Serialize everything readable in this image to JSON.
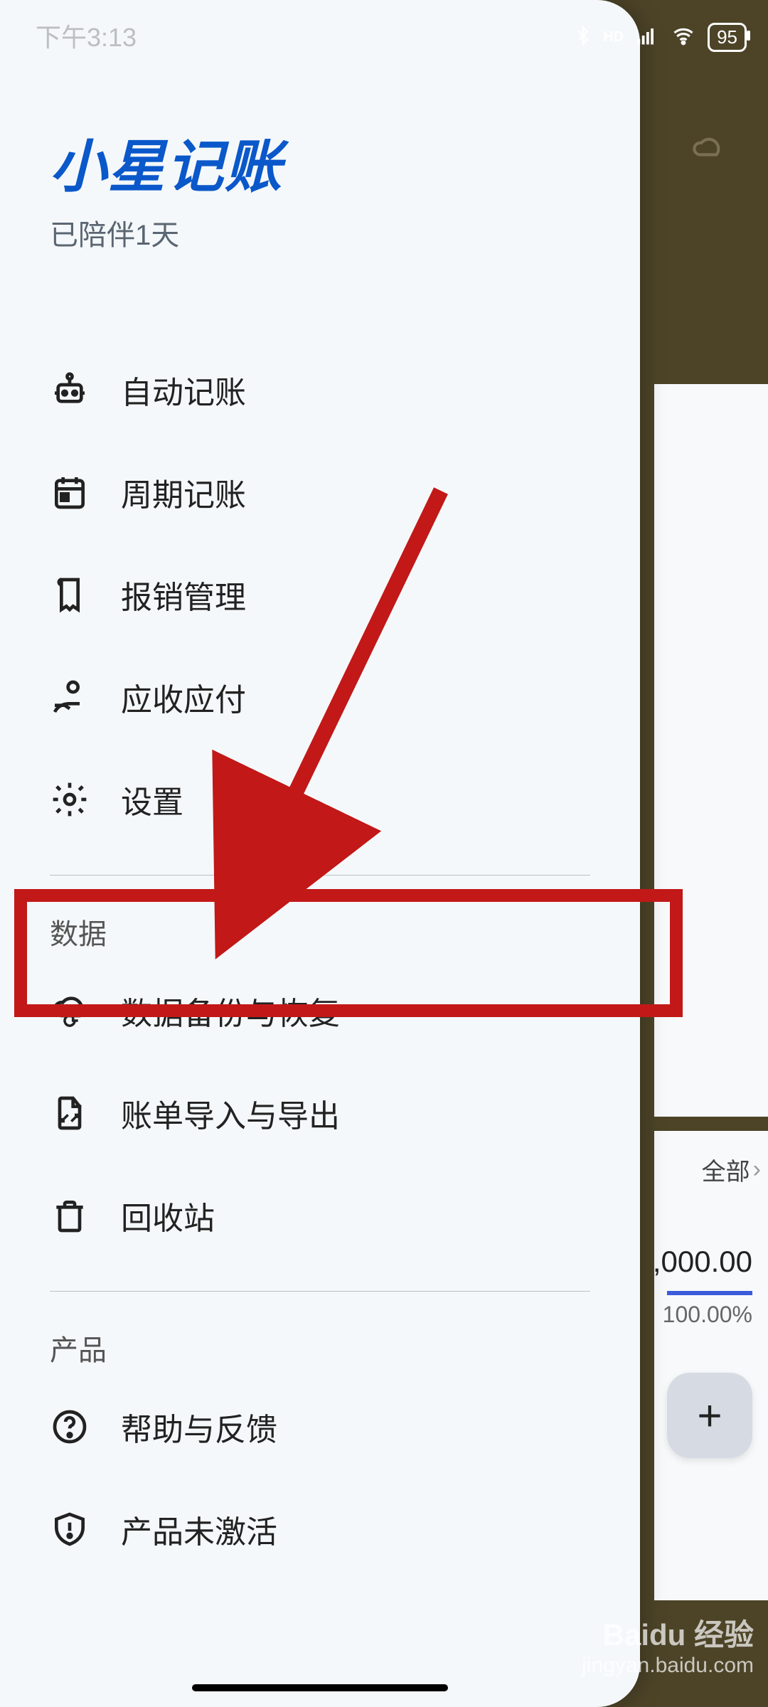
{
  "statusbar": {
    "time": "下午3:13",
    "battery": "95"
  },
  "drawer": {
    "app_title": "小星记账",
    "subtitle": "已陪伴1天",
    "menu_main": [
      {
        "label": "自动记账",
        "icon": "robot-icon"
      },
      {
        "label": "周期记账",
        "icon": "calendar-icon"
      },
      {
        "label": "报销管理",
        "icon": "receipt-icon"
      },
      {
        "label": "应收应付",
        "icon": "hand-coin-icon"
      },
      {
        "label": "设置",
        "icon": "gear-icon"
      }
    ],
    "section_data": "数据",
    "menu_data": [
      {
        "label": "数据备份与恢复",
        "icon": "cloud-sync-icon"
      },
      {
        "label": "账单导入与导出",
        "icon": "file-transfer-icon"
      },
      {
        "label": "回收站",
        "icon": "trash-icon"
      }
    ],
    "section_product": "产品",
    "menu_product": [
      {
        "label": "帮助与反馈",
        "icon": "help-icon"
      },
      {
        "label": "产品未激活",
        "icon": "shield-alert-icon"
      }
    ]
  },
  "peek": {
    "all_label": "全部",
    "amount": ",000.00",
    "percent": "100.00%",
    "plus": "+"
  },
  "watermark": {
    "brand": "Baidu 经验",
    "url": "jingyan.baidu.com"
  }
}
